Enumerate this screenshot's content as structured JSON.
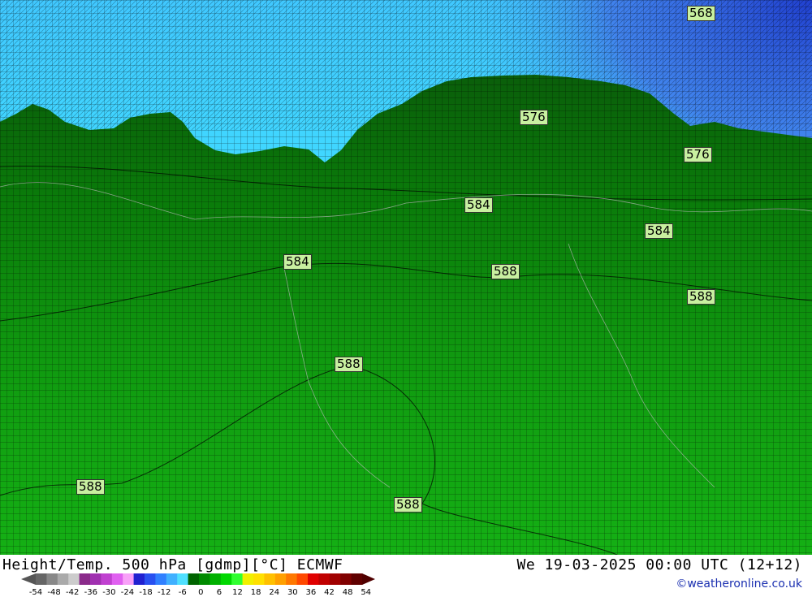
{
  "map": {
    "contour_labels": [
      "568",
      "576",
      "576",
      "584",
      "584",
      "584",
      "588",
      "588",
      "588",
      "588",
      "588"
    ]
  },
  "footer": {
    "title_left": "Height/Temp. 500 hPa [gdmp][°C] ECMWF",
    "title_right": "We 19-03-2025 00:00 UTC (12+12)",
    "credit": "©weatheronline.co.uk"
  },
  "colorbar": {
    "ticks": [
      "-54",
      "-48",
      "-42",
      "-36",
      "-30",
      "-24",
      "-18",
      "-12",
      "-6",
      "0",
      "6",
      "12",
      "18",
      "24",
      "30",
      "36",
      "42",
      "48",
      "54"
    ],
    "colors": [
      "#666666",
      "#888888",
      "#aaaaaa",
      "#cccccc",
      "#8a2a8a",
      "#a030b0",
      "#c040d0",
      "#e060f0",
      "#f8a0f8",
      "#2020d0",
      "#2850f0",
      "#3080ff",
      "#40b0ff",
      "#50e0ff",
      "#006400",
      "#008a00",
      "#00b000",
      "#00d800",
      "#30ff30",
      "#f0f000",
      "#ffe000",
      "#ffc000",
      "#ffa000",
      "#ff7800",
      "#ff4800",
      "#e00000",
      "#c00000",
      "#a00000",
      "#800000",
      "#600000"
    ]
  },
  "colors": {
    "upper_cold": "#40e8ff",
    "dark_green": "#0a6a0a",
    "green": "#14a014",
    "blue_corner": "#3050e0"
  }
}
